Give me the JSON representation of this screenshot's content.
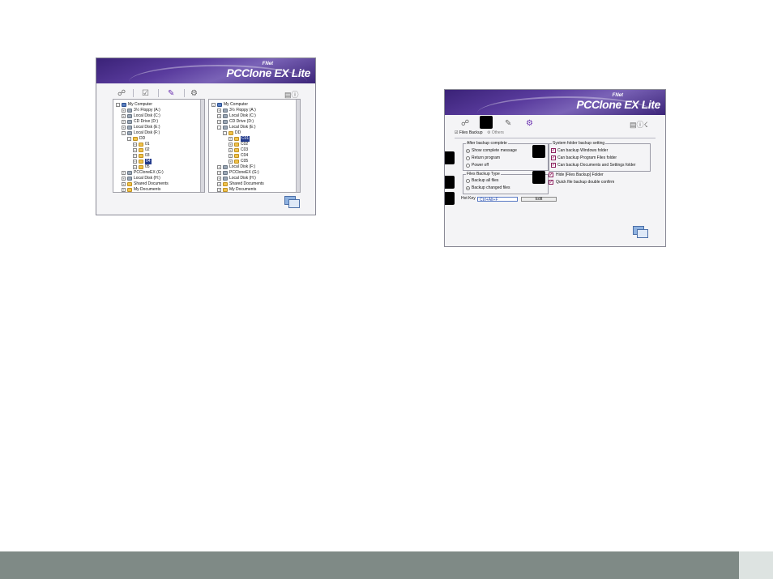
{
  "app": {
    "brand_prefix": "FNet",
    "brand_name": "PCClone EX Lite"
  },
  "explorer_window": {
    "left_tree": [
      {
        "label": "My Computer",
        "icon": "computer-icon",
        "expander": "-",
        "indent": 0
      },
      {
        "label": "3½ Floppy (A:)",
        "icon": "floppy-icon",
        "expander": "+",
        "indent": 1
      },
      {
        "label": "Local Disk (C:)",
        "icon": "drive-icon",
        "expander": "+",
        "indent": 1
      },
      {
        "label": "CD Drive (D:)",
        "icon": "cd-icon",
        "expander": "+",
        "indent": 1
      },
      {
        "label": "Local Disk (E:)",
        "icon": "drive-icon",
        "expander": "+",
        "indent": 1
      },
      {
        "label": "Local Disk (F:)",
        "icon": "drive-icon",
        "expander": "-",
        "indent": 1
      },
      {
        "label": "DD",
        "icon": "folder-icon",
        "expander": "-",
        "indent": 2
      },
      {
        "label": "01",
        "icon": "folder-icon",
        "expander": "+",
        "indent": 3
      },
      {
        "label": "02",
        "icon": "folder-icon",
        "expander": "+",
        "indent": 3
      },
      {
        "label": "03",
        "icon": "folder-icon",
        "expander": "+",
        "indent": 3
      },
      {
        "label": "04",
        "icon": "folder-icon",
        "expander": "+",
        "indent": 3,
        "selected": true
      },
      {
        "label": "05",
        "icon": "folder-icon",
        "expander": "+",
        "indent": 3
      },
      {
        "label": "PCCloneEX (G:)",
        "icon": "drive-icon",
        "expander": "+",
        "indent": 1
      },
      {
        "label": "Local Disk (H:)",
        "icon": "drive-icon",
        "expander": "+",
        "indent": 1
      },
      {
        "label": "Shared Documents",
        "icon": "folder-icon",
        "expander": "+",
        "indent": 1
      },
      {
        "label": "My Documents",
        "icon": "folder-icon",
        "expander": "+",
        "indent": 1
      }
    ],
    "right_tree": [
      {
        "label": "My Computer",
        "icon": "computer-icon",
        "expander": "-",
        "indent": 0
      },
      {
        "label": "3½ Floppy (A:)",
        "icon": "floppy-icon",
        "expander": "+",
        "indent": 1
      },
      {
        "label": "Local Disk (C:)",
        "icon": "drive-icon",
        "expander": "+",
        "indent": 1
      },
      {
        "label": "CD Drive (D:)",
        "icon": "cd-icon",
        "expander": "+",
        "indent": 1
      },
      {
        "label": "Local Disk (E:)",
        "icon": "drive-icon",
        "expander": "-",
        "indent": 1
      },
      {
        "label": "DD",
        "icon": "folder-icon",
        "expander": "-",
        "indent": 2
      },
      {
        "label": "C01",
        "icon": "folder-icon",
        "expander": "+",
        "indent": 3,
        "selected": true
      },
      {
        "label": "C02",
        "icon": "folder-icon",
        "expander": "+",
        "indent": 3
      },
      {
        "label": "C03",
        "icon": "folder-icon",
        "expander": "+",
        "indent": 3
      },
      {
        "label": "C04",
        "icon": "folder-icon",
        "expander": "+",
        "indent": 3
      },
      {
        "label": "C05",
        "icon": "folder-icon",
        "expander": "+",
        "indent": 3
      },
      {
        "label": "Local Disk (F:)",
        "icon": "drive-icon",
        "expander": "+",
        "indent": 1
      },
      {
        "label": "PCCloneEX (G:)",
        "icon": "drive-icon",
        "expander": "+",
        "indent": 1
      },
      {
        "label": "Local Disk (H:)",
        "icon": "drive-icon",
        "expander": "+",
        "indent": 1
      },
      {
        "label": "Shared Documents",
        "icon": "folder-icon",
        "expander": "+",
        "indent": 1
      },
      {
        "label": "My Documents",
        "icon": "folder-icon",
        "expander": "+",
        "indent": 1
      }
    ]
  },
  "options_window": {
    "tabs": [
      "Files Backup",
      "Others"
    ],
    "after_backup": {
      "title": "After backup complete",
      "options": [
        "Show complete message",
        "Return program",
        "Power off"
      ],
      "selected": 0
    },
    "backup_type": {
      "title": "Files Backup Type",
      "options": [
        "Backup all files",
        "Backup changed files"
      ],
      "selected": 1
    },
    "system_folder": {
      "title": "System folder backup setting",
      "options": [
        "Can backup Windows folder",
        "Can backup Program Files folder",
        "Can backup Documents and Settings folder"
      ]
    },
    "hide_folder_label": "Hide [Files Backup] Folder",
    "quick_backup_label": "Quick file backup double confirm",
    "hotkey": {
      "label": "Hot Key",
      "value": "Ctrl+Alt+F",
      "edit_label": "Edit"
    }
  },
  "footer": {
    "page_number": ""
  }
}
